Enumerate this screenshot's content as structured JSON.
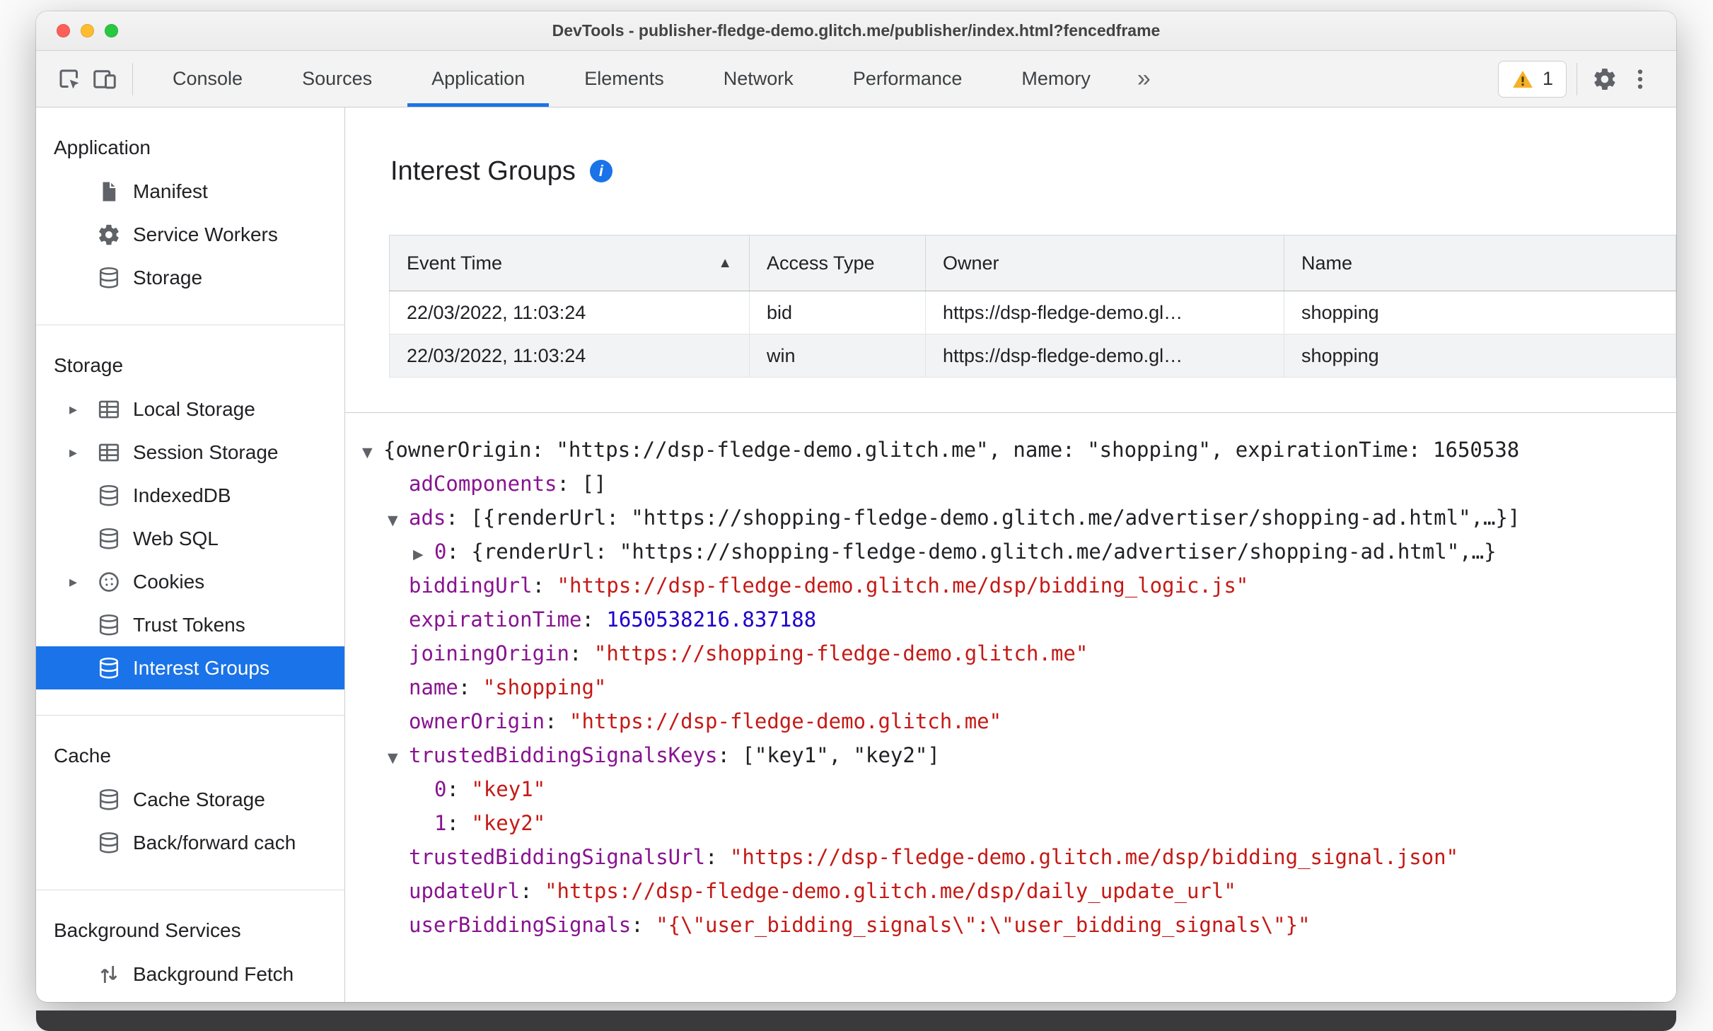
{
  "colors": {
    "accent": "#1a73e8",
    "selected_item_bg": "#1a73e8",
    "warning": "#f6b026",
    "json_key": "#881391",
    "json_string": "#c41a16",
    "json_number": "#1c00cf"
  },
  "titlebar": {
    "title": "DevTools - publisher-fledge-demo.glitch.me/publisher/index.html?fencedframe",
    "traffic_lights": [
      "close",
      "minimize",
      "zoom"
    ]
  },
  "toolbar": {
    "left_icons": [
      "inspect-icon",
      "device-toolbar-icon"
    ],
    "tabs": [
      {
        "label": "Console",
        "active": false
      },
      {
        "label": "Sources",
        "active": false
      },
      {
        "label": "Application",
        "active": true
      },
      {
        "label": "Elements",
        "active": false
      },
      {
        "label": "Network",
        "active": false
      },
      {
        "label": "Performance",
        "active": false
      },
      {
        "label": "Memory",
        "active": false
      }
    ],
    "more_tabs": "»",
    "warning_count": "1",
    "right_icons": [
      "gear-icon",
      "kebab-menu-icon"
    ]
  },
  "sidebar": {
    "sections": [
      {
        "header": "Application",
        "items": [
          {
            "label": "Manifest",
            "icon": "document",
            "expandable": false,
            "selected": false
          },
          {
            "label": "Service Workers",
            "icon": "gear",
            "expandable": false,
            "selected": false
          },
          {
            "label": "Storage",
            "icon": "database",
            "expandable": false,
            "selected": false
          }
        ]
      },
      {
        "header": "Storage",
        "items": [
          {
            "label": "Local Storage",
            "icon": "grid",
            "expandable": true,
            "selected": false
          },
          {
            "label": "Session Storage",
            "icon": "grid",
            "expandable": true,
            "selected": false
          },
          {
            "label": "IndexedDB",
            "icon": "database",
            "expandable": false,
            "selected": false
          },
          {
            "label": "Web SQL",
            "icon": "database",
            "expandable": false,
            "selected": false
          },
          {
            "label": "Cookies",
            "icon": "cookie",
            "expandable": true,
            "selected": false
          },
          {
            "label": "Trust Tokens",
            "icon": "database",
            "expandable": false,
            "selected": false
          },
          {
            "label": "Interest Groups",
            "icon": "database",
            "expandable": false,
            "selected": true
          }
        ]
      },
      {
        "header": "Cache",
        "items": [
          {
            "label": "Cache Storage",
            "icon": "database",
            "expandable": false,
            "selected": false
          },
          {
            "label": "Back/forward cach",
            "icon": "database",
            "expandable": false,
            "selected": false
          }
        ]
      },
      {
        "header": "Background Services",
        "items": [
          {
            "label": "Background Fetch",
            "icon": "updown",
            "expandable": false,
            "selected": false
          }
        ]
      }
    ]
  },
  "main": {
    "title": "Interest Groups",
    "table": {
      "columns": [
        {
          "label": "Event Time",
          "sort": "asc"
        },
        {
          "label": "Access Type",
          "sort": null
        },
        {
          "label": "Owner",
          "sort": null
        },
        {
          "label": "Name",
          "sort": null
        }
      ],
      "rows": [
        [
          "22/03/2022, 11:03:24",
          "bid",
          "https://dsp-fledge-demo.gl…",
          "shopping"
        ],
        [
          "22/03/2022, 11:03:24",
          "win",
          "https://dsp-fledge-demo.gl…",
          "shopping"
        ]
      ]
    },
    "tree": {
      "lines": [
        {
          "level": 0,
          "arrow": "down",
          "segments": [
            {
              "t": "{ownerOrigin: \"https://dsp-fledge-demo.glitch.me\", name: \"shopping\", expirationTime: 1650538",
              "c": "plain"
            }
          ]
        },
        {
          "level": 1,
          "arrow": null,
          "segments": [
            {
              "t": "adComponents",
              "c": "key"
            },
            {
              "t": ": ",
              "c": "plain"
            },
            {
              "t": "[]",
              "c": "plain"
            }
          ]
        },
        {
          "level": 1,
          "arrow": "down",
          "segments": [
            {
              "t": "ads",
              "c": "key"
            },
            {
              "t": ": ",
              "c": "plain"
            },
            {
              "t": "[{renderUrl: \"https://shopping-fledge-demo.glitch.me/advertiser/shopping-ad.html\",…}]",
              "c": "plain"
            }
          ]
        },
        {
          "level": 2,
          "arrow": "right",
          "segments": [
            {
              "t": "0",
              "c": "key"
            },
            {
              "t": ": ",
              "c": "plain"
            },
            {
              "t": "{renderUrl: \"https://shopping-fledge-demo.glitch.me/advertiser/shopping-ad.html\",…}",
              "c": "plain"
            }
          ]
        },
        {
          "level": 1,
          "arrow": null,
          "segments": [
            {
              "t": "biddingUrl",
              "c": "key"
            },
            {
              "t": ": ",
              "c": "plain"
            },
            {
              "t": "\"https://dsp-fledge-demo.glitch.me/dsp/bidding_logic.js\"",
              "c": "string"
            }
          ]
        },
        {
          "level": 1,
          "arrow": null,
          "segments": [
            {
              "t": "expirationTime",
              "c": "key"
            },
            {
              "t": ": ",
              "c": "plain"
            },
            {
              "t": "1650538216.837188",
              "c": "number"
            }
          ]
        },
        {
          "level": 1,
          "arrow": null,
          "segments": [
            {
              "t": "joiningOrigin",
              "c": "key"
            },
            {
              "t": ": ",
              "c": "plain"
            },
            {
              "t": "\"https://shopping-fledge-demo.glitch.me\"",
              "c": "string"
            }
          ]
        },
        {
          "level": 1,
          "arrow": null,
          "segments": [
            {
              "t": "name",
              "c": "key"
            },
            {
              "t": ": ",
              "c": "plain"
            },
            {
              "t": "\"shopping\"",
              "c": "string"
            }
          ]
        },
        {
          "level": 1,
          "arrow": null,
          "segments": [
            {
              "t": "ownerOrigin",
              "c": "key"
            },
            {
              "t": ": ",
              "c": "plain"
            },
            {
              "t": "\"https://dsp-fledge-demo.glitch.me\"",
              "c": "string"
            }
          ]
        },
        {
          "level": 1,
          "arrow": "down",
          "segments": [
            {
              "t": "trustedBiddingSignalsKeys",
              "c": "key"
            },
            {
              "t": ": ",
              "c": "plain"
            },
            {
              "t": "[\"key1\", \"key2\"]",
              "c": "plain"
            }
          ]
        },
        {
          "level": 2,
          "arrow": null,
          "segments": [
            {
              "t": "0",
              "c": "key"
            },
            {
              "t": ": ",
              "c": "plain"
            },
            {
              "t": "\"key1\"",
              "c": "string"
            }
          ]
        },
        {
          "level": 2,
          "arrow": null,
          "segments": [
            {
              "t": "1",
              "c": "key"
            },
            {
              "t": ": ",
              "c": "plain"
            },
            {
              "t": "\"key2\"",
              "c": "string"
            }
          ]
        },
        {
          "level": 1,
          "arrow": null,
          "segments": [
            {
              "t": "trustedBiddingSignalsUrl",
              "c": "key"
            },
            {
              "t": ": ",
              "c": "plain"
            },
            {
              "t": "\"https://dsp-fledge-demo.glitch.me/dsp/bidding_signal.json\"",
              "c": "string"
            }
          ]
        },
        {
          "level": 1,
          "arrow": null,
          "segments": [
            {
              "t": "updateUrl",
              "c": "key"
            },
            {
              "t": ": ",
              "c": "plain"
            },
            {
              "t": "\"https://dsp-fledge-demo.glitch.me/dsp/daily_update_url\"",
              "c": "string"
            }
          ]
        },
        {
          "level": 1,
          "arrow": null,
          "segments": [
            {
              "t": "userBiddingSignals",
              "c": "key"
            },
            {
              "t": ": ",
              "c": "plain"
            },
            {
              "t": "\"{\\\"user_bidding_signals\\\":\\\"user_bidding_signals\\\"}\"",
              "c": "string"
            }
          ]
        }
      ]
    }
  }
}
